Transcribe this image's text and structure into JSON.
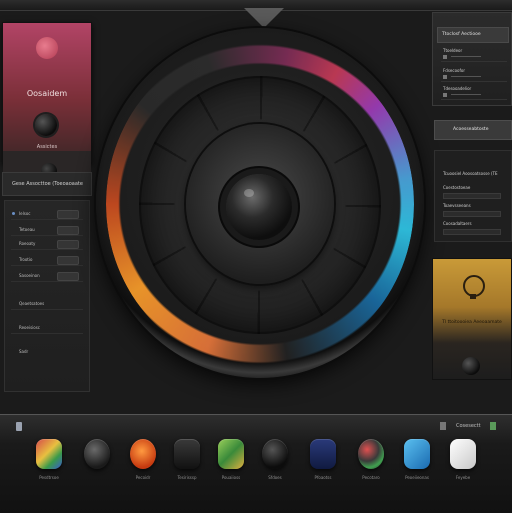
{
  "left_card": {
    "title": "Oosaidem",
    "subtitle": "Assictes"
  },
  "left_header": {
    "label": "Gese Assocttoe (Toeoaoaate"
  },
  "left_list": [
    {
      "label": "Ielsoc"
    },
    {
      "label": "Tetoeau"
    },
    {
      "label": "Roeoaty"
    },
    {
      "label": "Trootio"
    },
    {
      "label": "Sasoeinon"
    },
    {
      "label": "Qeaetsatoes"
    },
    {
      "label": "Reoeisiosc"
    },
    {
      "label": "Sadr"
    }
  ],
  "right_top": {
    "title": "Ttoclosf Aectiooe",
    "rows": [
      {
        "label": "Ttoeldeor"
      },
      {
        "label": "Fdsecoofor"
      },
      {
        "label": "Tdesooadelior"
      }
    ]
  },
  "right_mid": {
    "label": "Acoesseabtoste"
  },
  "right_list": {
    "items": [
      {
        "label": "Tcuoosiel Aoosoatsosse (TE"
      },
      {
        "label": "Coestostoeae"
      },
      {
        "label": "Toaevsseeans"
      },
      {
        "label": "Coosadaltaers"
      }
    ]
  },
  "right_gold": {
    "label": "Tl ttoitoooiea Aeeoaamate"
  },
  "dock": {
    "status_text": "Cosesectt",
    "apps": [
      {
        "label": "Pesdtrsoe",
        "icon": "gem-icon"
      },
      {
        "label": "",
        "icon": "sphere-icon"
      },
      {
        "label": "Pecoidr",
        "icon": "pencil-icon"
      },
      {
        "label": "Tesirisssp",
        "icon": "bookmark-icon"
      },
      {
        "label": "Pouaiioss",
        "icon": "cube-icon"
      },
      {
        "label": "Sfdoes",
        "icon": "dark-orb-icon"
      },
      {
        "label": "Pfoaotss",
        "icon": "book-icon"
      },
      {
        "label": "Pecotaro",
        "icon": "color-dots-icon"
      },
      {
        "label": "Peoeiieonas",
        "icon": "paintbrush-icon"
      },
      {
        "label": "Feyebe",
        "icon": "white-gem-icon"
      }
    ]
  },
  "colors": {
    "accent_pink": "#b24466",
    "accent_gold": "#c99a38",
    "ring_orange": "#f39a2a",
    "ring_blue": "#2ec1e0"
  }
}
